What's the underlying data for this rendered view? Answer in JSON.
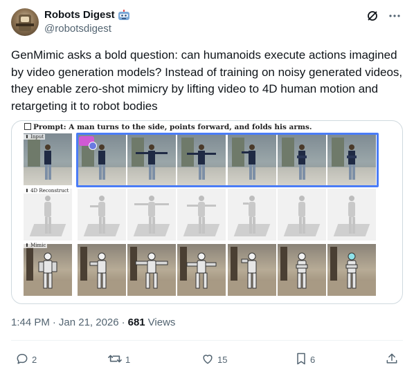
{
  "author": {
    "display_name": "Robots Digest",
    "handle": "@robotsdigest",
    "emoji": "robot-face-emoji"
  },
  "tweet": {
    "text": "GenMimic asks a bold question: can humanoids execute actions imagined by video generation models? Instead of training on noisy generated videos, they enable zero-shot mimicry by lifting video to 4D human motion and retargeting it to robot bodies"
  },
  "media": {
    "prompt": "Prompt: A man turns to the side, points forward, and folds his arms.",
    "rows": [
      {
        "label": "Input",
        "frames": 7
      },
      {
        "label": "4D Reconstruct",
        "frames": 7
      },
      {
        "label": "Mimic",
        "frames": 7
      }
    ]
  },
  "meta": {
    "time": "1:44 PM",
    "sep1": "·",
    "date": "Jan 21, 2026",
    "sep2": "·",
    "views_count": "681",
    "views_label": "Views"
  },
  "actions": {
    "reply_count": "2",
    "repost_count": "1",
    "like_count": "15",
    "bookmark_count": "6"
  },
  "colors": {
    "text": "#0f1419",
    "secondary": "#536471",
    "border": "#cfd9de",
    "highlight": "#4a7cf7"
  },
  "icons": [
    "grok-icon",
    "more-icon",
    "reply-icon",
    "repost-icon",
    "like-icon",
    "bookmark-icon",
    "share-icon"
  ]
}
